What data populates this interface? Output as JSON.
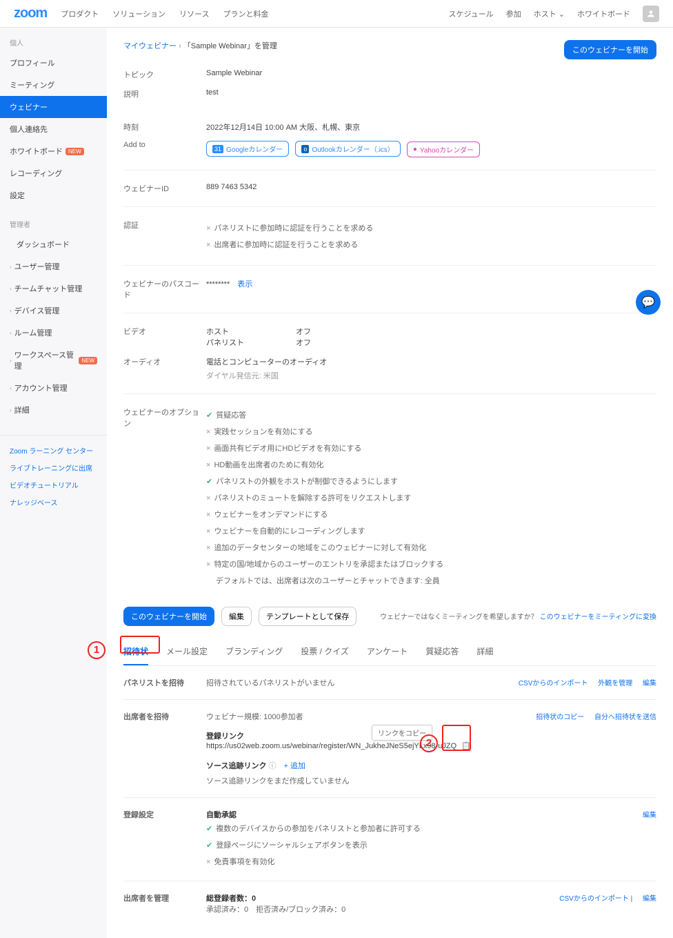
{
  "brand": "zoom",
  "topnav": {
    "product": "プロダクト",
    "solution": "ソリューション",
    "resource": "リソース",
    "plan": "プランと料金"
  },
  "topright": {
    "schedule": "スケジュール",
    "join": "参加",
    "host": "ホスト",
    "whiteboard": "ホワイトボード"
  },
  "sidebar": {
    "personal_label": "個人",
    "profile": "プロフィール",
    "meeting": "ミーティング",
    "webinar": "ウェビナー",
    "contacts": "個人連絡先",
    "whiteboard": "ホワイトボード",
    "recording": "レコーディング",
    "settings": "設定",
    "admin_label": "管理者",
    "dashboard": "ダッシュボード",
    "user_mgmt": "ユーザー管理",
    "teamchat": "チームチャット管理",
    "device": "デバイス管理",
    "room": "ルーム管理",
    "workspace": "ワークスペース管理",
    "account": "アカウント管理",
    "detail": "詳細",
    "new": "NEW",
    "learning": "Zoom ラーニング センター",
    "livetraining": "ライブトレーニングに出席",
    "videotut": "ビデオチュートリアル",
    "kb": "ナレッジベース"
  },
  "breadcrumb": {
    "root": "マイウェビナー",
    "current": "「Sample Webinar」を管理"
  },
  "start_button": "このウェビナーを開始",
  "details": {
    "topic_label": "トピック",
    "topic_val": "Sample Webinar",
    "desc_label": "説明",
    "desc_val": "test",
    "time_label": "時刻",
    "time_val": "2022年12月14日 10:00 AM 大阪、札幌、東京",
    "addto_label": "Add to",
    "cal_google": "Googleカレンダー",
    "cal_outlook": "Outlookカレンダー（.ics）",
    "cal_yahoo": "Yahooカレンダー",
    "id_label": "ウェビナーID",
    "id_val": "889 7463 5342",
    "auth_label": "認証",
    "auth1": "パネリストに参加時に認証を行うことを求める",
    "auth2": "出席者に参加時に認証を行うことを求める",
    "passcode_label": "ウェビナーのパスコード",
    "passcode_val": "********",
    "show": "表示",
    "video_label": "ビデオ",
    "host": "ホスト",
    "panelist": "パネリスト",
    "off": "オフ",
    "audio_label": "オーディオ",
    "audio_val": "電話とコンピューターのオーディオ",
    "dial": "ダイヤル発信元: 米国",
    "options_label": "ウェビナーのオプション",
    "opt_qa": "質疑応答",
    "opt_practice": "実践セッションを有効にする",
    "opt_hd": "画面共有ビデオ用にHDビデオを有効にする",
    "opt_hd2": "HD動画を出席者のために有効化",
    "opt_appearance": "パネリストの外観をホストが制御できるようにします",
    "opt_mute": "パネリストのミュートを解除する許可をリクエストします",
    "opt_ondemand": "ウェビナーをオンデマンドにする",
    "opt_autorec": "ウェビナーを自動的にレコーディングします",
    "opt_datacenter": "追加のデータセンターの地域をこのウェビナーに対して有効化",
    "opt_block": "特定の国/地域からのユーザーのエントリを承認またはブロックする",
    "opt_chat": "デフォルトでは、出席者は次のユーザーとチャットできます: 全員"
  },
  "actions": {
    "start": "このウェビナーを開始",
    "edit": "編集",
    "template": "テンプレートとして保存"
  },
  "convert": {
    "q": "ウェビナーではなくミーティングを希望しますか？",
    "link": "このウェビナーをミーティングに変換"
  },
  "tabs": {
    "invite": "招待状",
    "mail": "メール設定",
    "branding": "ブランディング",
    "poll": "投票 / クイズ",
    "survey": "アンケート",
    "qa": "質疑応答",
    "detail": "詳細"
  },
  "invite": {
    "panelist_label": "パネリストを招待",
    "panelist_none": "招待されているパネリストがいません",
    "csv_import": "CSVからのインポート",
    "manage_appearance": "外観を管理",
    "edit": "編集",
    "attendee_label": "出席者を招待",
    "scale": "ウェビナー規模: 1000参加者",
    "copy_invite": "招待状のコピー",
    "self_send": "自分へ招待状を送信",
    "reg_link_label": "登録リンク",
    "reg_link": "https://us02web.zoom.us/webinar/register/WN_JukheJNeS5ejYLx98-uJZQ",
    "copy_tooltip": "リンクをコピー",
    "source_label": "ソース追跡リンク",
    "add": "+ 追加",
    "source_none": "ソース追跡リンクをまだ作成していません",
    "regset_label": "登録設定",
    "auto": "自動承認",
    "regopt1": "複数のデバイスからの参加をパネリストと参加者に許可する",
    "regopt2": "登録ページにソーシャルシェアボタンを表示",
    "regopt3": "免責事項を有効化",
    "manage_label": "出席者を管理",
    "total": "総登録者数：0",
    "approved": "承認済み：0　拒否済み/ブロック済み：0",
    "csv_import2": "CSVからのインポート"
  }
}
